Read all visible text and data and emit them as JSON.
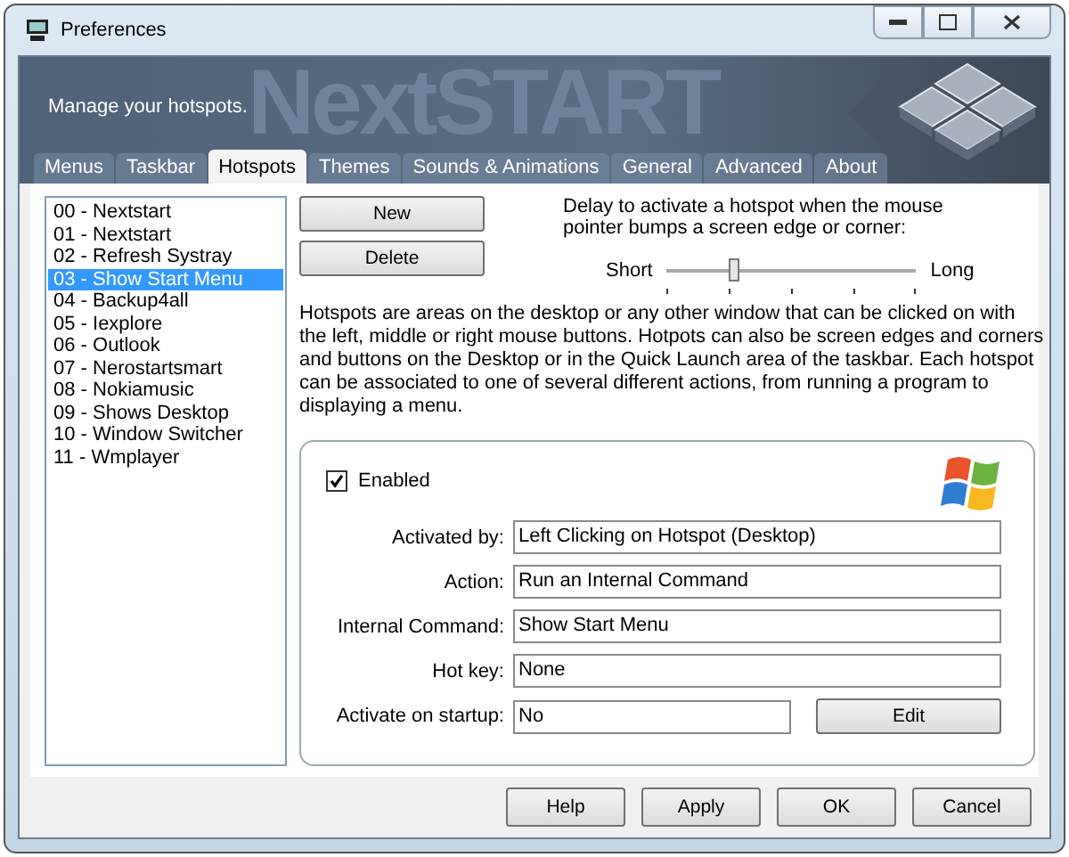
{
  "window": {
    "title": "Preferences"
  },
  "banner": {
    "logo_text": "NextSTART",
    "subtitle": "Manage your hotspots."
  },
  "tabs": [
    {
      "label": "Menus",
      "selected": false
    },
    {
      "label": "Taskbar",
      "selected": false
    },
    {
      "label": "Hotspots",
      "selected": true
    },
    {
      "label": "Themes",
      "selected": false
    },
    {
      "label": "Sounds & Animations",
      "selected": false
    },
    {
      "label": "General",
      "selected": false
    },
    {
      "label": "Advanced",
      "selected": false
    },
    {
      "label": "About",
      "selected": false
    }
  ],
  "hotspots": [
    {
      "label": "00 - Nextstart",
      "selected": false
    },
    {
      "label": "01 - Nextstart",
      "selected": false
    },
    {
      "label": "02 - Refresh Systray",
      "selected": false
    },
    {
      "label": "03 - Show Start Menu",
      "selected": true
    },
    {
      "label": "04 - Backup4all",
      "selected": false
    },
    {
      "label": "05 - Iexplore",
      "selected": false
    },
    {
      "label": "06 - Outlook",
      "selected": false
    },
    {
      "label": "07 - Nerostartsmart",
      "selected": false
    },
    {
      "label": "08 - Nokiamusic",
      "selected": false
    },
    {
      "label": "09 - Shows Desktop",
      "selected": false
    },
    {
      "label": "10 - Window Switcher",
      "selected": false
    },
    {
      "label": "11 - Wmplayer",
      "selected": false
    }
  ],
  "list_buttons": [
    "New",
    "Delete"
  ],
  "delay": {
    "description": "Delay to activate a hotspot when the mouse pointer bumps a screen edge or corner:",
    "min_label": "Short",
    "max_label": "Long",
    "level": 0.27
  },
  "help_text": "Hotspots are areas on the desktop or any other window that can be clicked on with the left, middle or right mouse buttons. Hotpots can also be screen edges and corners and buttons on the Desktop or in the Quick Launch area of the taskbar. Each hotspot can be associated to one of several different actions, from running a program to displaying a menu.",
  "details": {
    "enabled": {
      "label": "Enabled",
      "checked": true
    },
    "fields": [
      {
        "label": "Activated by:",
        "value": "Left Clicking on Hotspot (Desktop)"
      },
      {
        "label": "Action:",
        "value": "Run an Internal Command"
      },
      {
        "label": "Internal Command:",
        "value": "Show Start Menu"
      },
      {
        "label": "Hot key:",
        "value": "None"
      },
      {
        "label": "Activate on startup:",
        "value": "No",
        "button": "Edit"
      }
    ]
  },
  "buttons": [
    "Help",
    "Apply",
    "OK",
    "Cancel"
  ]
}
